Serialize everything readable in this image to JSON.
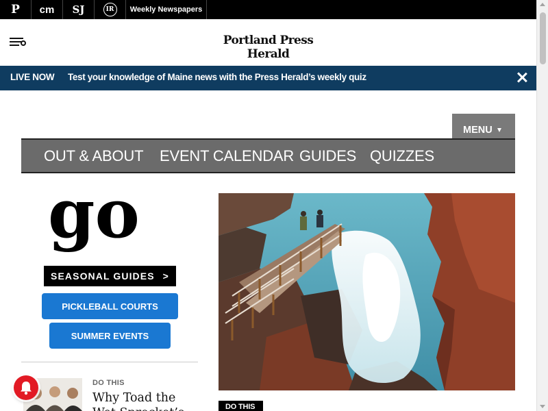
{
  "site_bar": {
    "sites": [
      {
        "label": "P",
        "icon": "pph-logo-icon"
      },
      {
        "label": "cm",
        "icon": "cm-logo-icon"
      },
      {
        "label": "SJ",
        "icon": "sj-logo-icon"
      },
      {
        "label": "IR",
        "icon": "ir-logo-icon"
      },
      {
        "label": "Weekly Newspapers"
      }
    ]
  },
  "masthead": {
    "brand": "Portland Press Herald",
    "menu_icon": "menu-search-icon"
  },
  "live_banner": {
    "tag": "LIVE NOW",
    "text": "Test your knowledge of Maine news with the Press Herald’s weekly quiz",
    "background": "#0f3c60",
    "close_icon": "close-icon"
  },
  "section_nav": {
    "menu_label": "MENU",
    "items": [
      {
        "label": "OUT & ABOUT"
      },
      {
        "label": "EVENT CALENDAR"
      },
      {
        "label": "GUIDES"
      },
      {
        "label": "QUIZZES"
      }
    ]
  },
  "go_section": {
    "logo_text": "go",
    "seasonal_button": "SEASONAL GUIDES",
    "seasonal_arrow": ">",
    "buttons": [
      {
        "label": "PICKLEBALL COURTS"
      },
      {
        "label": "SUMMER EVENTS"
      }
    ],
    "button_color": "#1a78d2"
  },
  "sidebar_story": {
    "kicker": "DO THIS",
    "headline": "Why Toad the Wet Sprocket’s"
  },
  "hero": {
    "kicker": "DO THIS"
  },
  "notification": {
    "color": "#e21a24"
  }
}
